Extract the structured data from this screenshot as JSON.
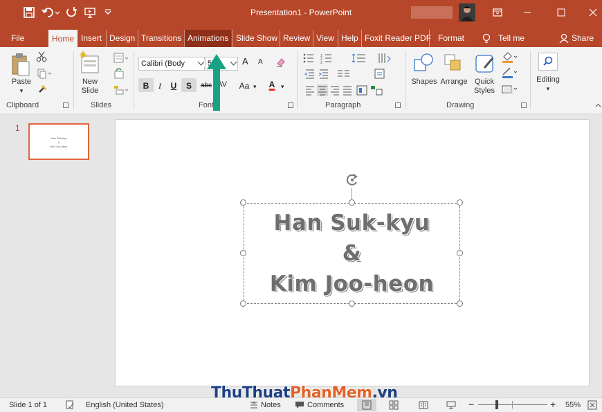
{
  "app": {
    "title": "Presentation1  -  PowerPoint",
    "accent": "#b7472a",
    "quick_access": [
      "save-icon",
      "undo-icon",
      "redo-icon",
      "start-from-beginning-icon",
      "customize-icon"
    ],
    "window_controls": [
      "ribbon-display-icon",
      "minimize-icon",
      "maximize-icon",
      "close-icon"
    ]
  },
  "tabs": [
    {
      "label": "File"
    },
    {
      "label": "Home",
      "active": true
    },
    {
      "label": "Insert"
    },
    {
      "label": "Design"
    },
    {
      "label": "Transitions"
    },
    {
      "label": "Animations",
      "highlighted": true
    },
    {
      "label": "Slide Show"
    },
    {
      "label": "Review"
    },
    {
      "label": "View"
    },
    {
      "label": "Help"
    },
    {
      "label": "Foxit Reader PDF"
    },
    {
      "label": "Format"
    }
  ],
  "tell_me": "Tell me",
  "share": "Share",
  "ribbon": {
    "clipboard": {
      "label": "Clipboard",
      "paste": "Paste"
    },
    "slides": {
      "label": "Slides",
      "new_slide_line1": "New",
      "new_slide_line2": "Slide"
    },
    "font": {
      "label": "Font",
      "font_name": "Calibri (Body",
      "font_size": "5",
      "bold": "B",
      "italic": "I",
      "underline": "U",
      "shadow": "S",
      "strike": "abc",
      "spacing": "AV",
      "case": "Aa",
      "color": "A",
      "grow": "A",
      "shrink": "A"
    },
    "paragraph": {
      "label": "Paragraph"
    },
    "drawing": {
      "label": "Drawing",
      "shapes": "Shapes",
      "arrange": "Arrange",
      "quick_line1": "Quick",
      "quick_line2": "Styles"
    },
    "editing": {
      "label": "Editing"
    }
  },
  "annotation": {
    "arrow_color": "#17a383",
    "points_to": "Animations"
  },
  "thumbnails": [
    {
      "number": "1",
      "line1": "Han Suk-kyu",
      "line2": "&",
      "line3": "Kim Joo-heon"
    }
  ],
  "slide": {
    "line1": "Han Suk-kyu",
    "line2": "&",
    "line3": "Kim Joo-heon"
  },
  "watermark": {
    "part1": "ThuThuat",
    "part2": "PhanMem",
    "part3": ".vn"
  },
  "status": {
    "slide": "Slide 1 of 1",
    "language": "English (United States)",
    "notes": "Notes",
    "comments": "Comments",
    "zoom": "55%"
  }
}
